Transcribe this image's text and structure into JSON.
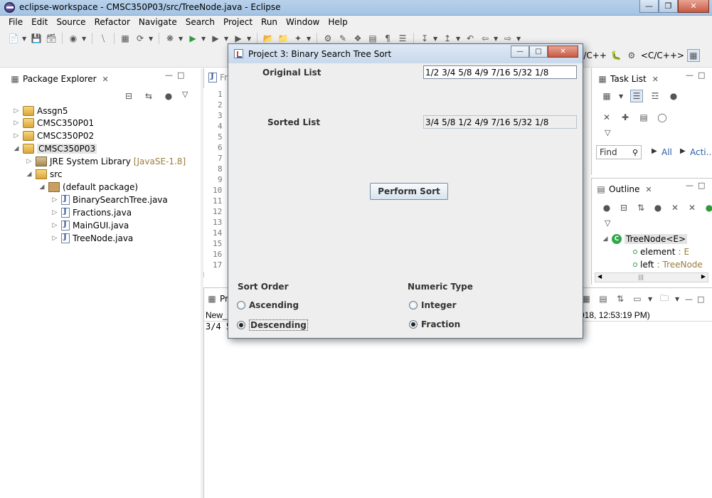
{
  "eclipse": {
    "title": "eclipse-workspace - CMSC350P03/src/TreeNode.java - Eclipse",
    "menu": [
      "File",
      "Edit",
      "Source",
      "Refactor",
      "Navigate",
      "Search",
      "Project",
      "Run",
      "Window",
      "Help"
    ],
    "perspectives": [
      "C/C++",
      "<C/C++>"
    ]
  },
  "package_explorer": {
    "tab_label": "Package Explorer",
    "items": {
      "assgn5": "Assgn5",
      "p01": "CMSC350P01",
      "p02": "CMSC350P02",
      "p03": "CMSC350P03",
      "jre": "JRE System Library",
      "jre_version": "[JavaSE-1.8]",
      "src": "src",
      "default_pkg": "(default package)",
      "files": [
        "BinarySearchTree.java",
        "Fractions.java",
        "MainGUI.java",
        "TreeNode.java"
      ]
    }
  },
  "editor": {
    "line_numbers": [
      "1",
      "2",
      "3",
      "4",
      "5",
      "6",
      "7",
      "8",
      "9",
      "10",
      "11",
      "12",
      "13",
      "14",
      "15",
      "16",
      "17"
    ]
  },
  "console": {
    "tab_label": "Pr",
    "line1_prefix": "New_c",
    "line1_suffix": "018, 12:53:19 PM)",
    "line2": "3/4 5"
  },
  "task_list": {
    "tab_label": "Task List",
    "find_placeholder": "Find",
    "all_label": "All",
    "acti_label": "Acti..."
  },
  "outline": {
    "tab_label": "Outline",
    "class_name": "TreeNode<E>",
    "fields": [
      {
        "name": "element",
        "type": "E"
      },
      {
        "name": "left",
        "type": "TreeNode"
      }
    ]
  },
  "dialog": {
    "title": "Project 3: Binary Search Tree Sort",
    "original_label": "Original List",
    "original_value": "1/2 3/4 5/8 4/9 7/16 5/32 1/8",
    "sorted_label": "Sorted List",
    "sorted_value": "3/4 5/8 1/2 4/9 7/16 5/32 1/8",
    "perform_button": "Perform Sort",
    "sort_order_label": "Sort Order",
    "ascending": "Ascending",
    "descending": "Descending",
    "numeric_type_label": "Numeric Type",
    "integer": "Integer",
    "fraction": "Fraction",
    "sort_order_selected": "Descending",
    "numeric_type_selected": "Fraction"
  }
}
